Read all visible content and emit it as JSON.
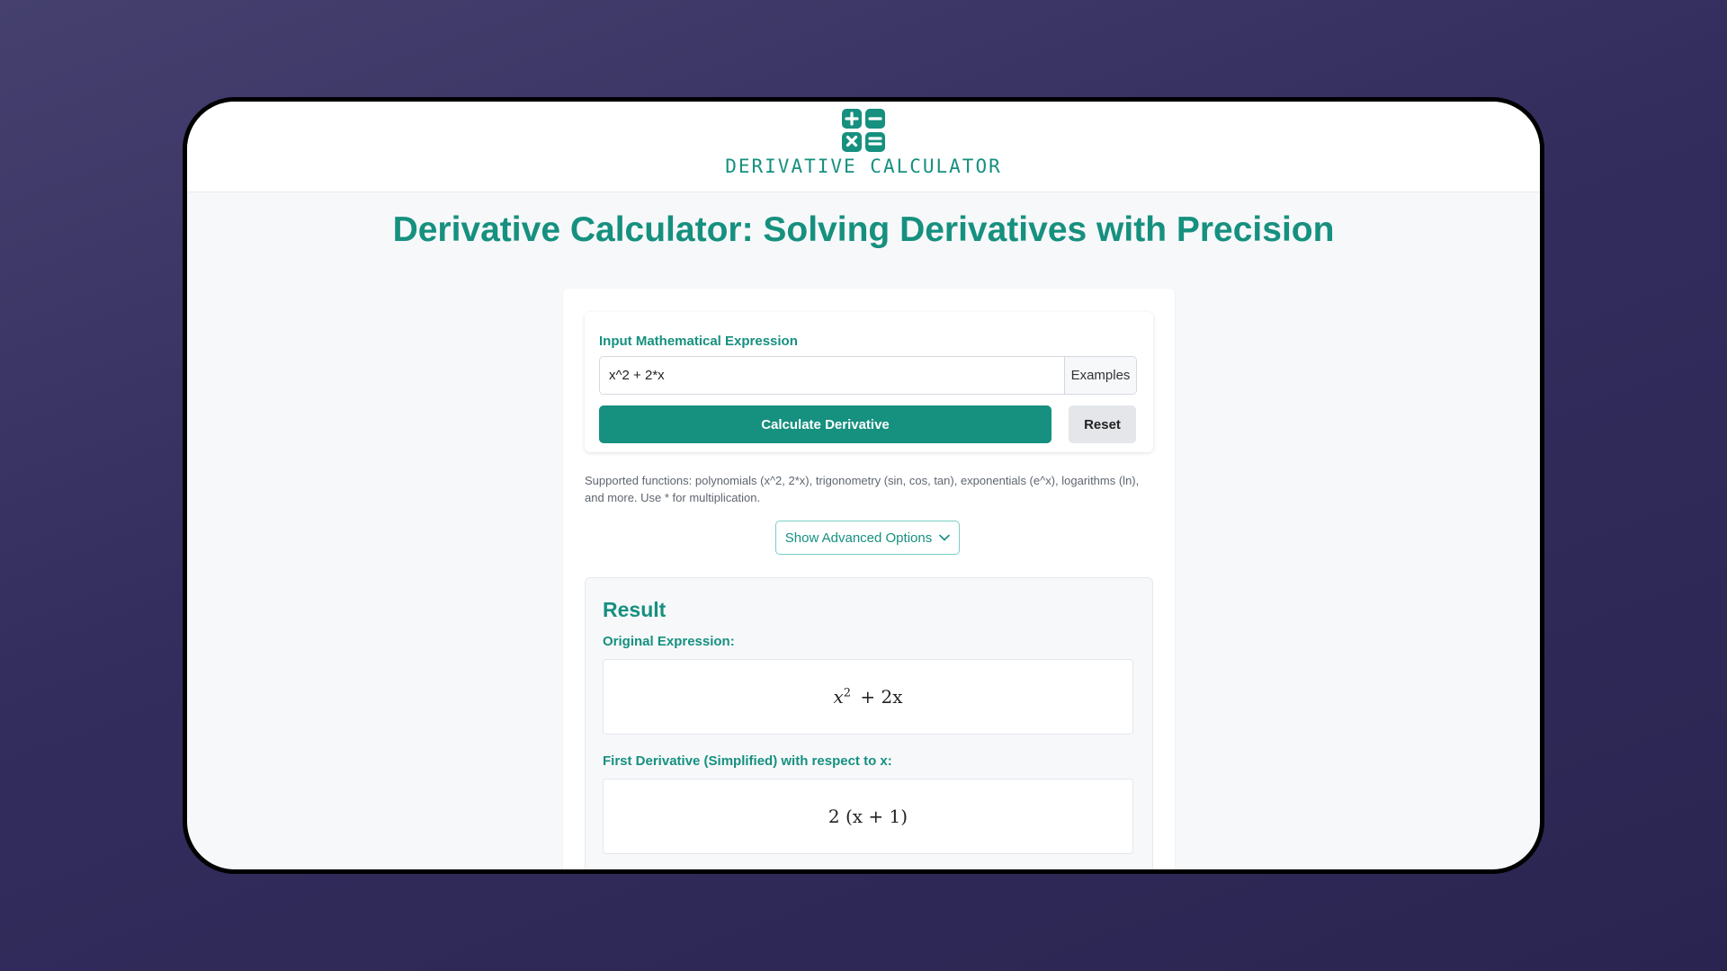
{
  "header": {
    "logo_icon": "calculator-icon",
    "logo_text": "DERIVATIVE CALCULATOR"
  },
  "page": {
    "title": "Derivative Calculator: Solving Derivatives with Precision"
  },
  "input_section": {
    "label": "Input Mathematical Expression",
    "value": "x^2 + 2*x",
    "examples_label": "Examples",
    "calculate_label": "Calculate Derivative",
    "reset_label": "Reset"
  },
  "supported_text": "Supported functions: polynomials (x^2, 2*x), trigonometry (sin, cos, tan), exponentials (e^x), logarithms (ln), and more. Use * for multiplication.",
  "advanced": {
    "label": "Show Advanced Options",
    "icon": "chevron-down-icon"
  },
  "result": {
    "title": "Result",
    "original_label": "Original Expression:",
    "original_expr": {
      "base": "x",
      "exp": "2",
      "rest": "+ 2x"
    },
    "derivative_label": "First Derivative (Simplified) with respect to x:",
    "derivative_expr": "2 (x + 1)"
  },
  "colors": {
    "accent": "#16907f",
    "background": "#3a3466"
  }
}
